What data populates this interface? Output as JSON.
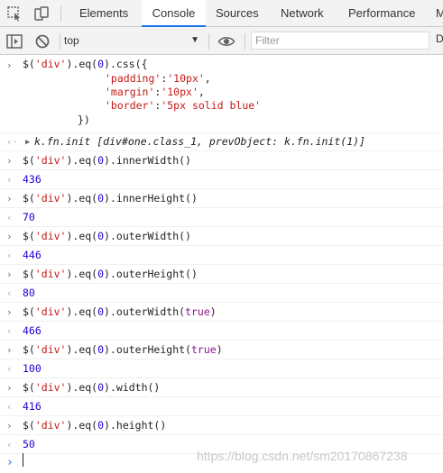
{
  "tabs": [
    {
      "label": "Elements"
    },
    {
      "label": "Console"
    },
    {
      "label": "Sources"
    },
    {
      "label": "Network"
    },
    {
      "label": "Performance"
    },
    {
      "label": "M"
    }
  ],
  "toolbar": {
    "context": "top",
    "filter_placeholder": "Filter",
    "truncated_label": "D"
  },
  "console": {
    "entry1": {
      "line1": "$('div').eq(0).css({",
      "k1": "'padding'",
      "v1": "'10px'",
      "k2": "'margin'",
      "v2": "'10px'",
      "k3": "'border'",
      "v3": "'5px solid blue'",
      "close": "})"
    },
    "result1": {
      "prefix": "k.fn.init [",
      "selector": "div#one.class_1",
      "rest": ", prevObject: k.fn.init(1)]"
    },
    "entries": [
      {
        "pre": "$(",
        "str": "'div'",
        "mid": ").eq(",
        "arg": "0",
        "post": ").innerWidth()",
        "result": "436"
      },
      {
        "pre": "$(",
        "str": "'div'",
        "mid": ").eq(",
        "arg": "0",
        "post": ").innerHeight()",
        "result": "70"
      },
      {
        "pre": "$(",
        "str": "'div'",
        "mid": ").eq(",
        "arg": "0",
        "post": ").outerWidth()",
        "result": "446"
      },
      {
        "pre": "$(",
        "str": "'div'",
        "mid": ").eq(",
        "arg": "0",
        "post": ").outerHeight()",
        "result": "80"
      },
      {
        "pre": "$(",
        "str": "'div'",
        "mid": ").eq(",
        "arg": "0",
        "post": ").outerWidth(",
        "kw": "true",
        "tail": ")",
        "result": "466"
      },
      {
        "pre": "$(",
        "str": "'div'",
        "mid": ").eq(",
        "arg": "0",
        "post": ").outerHeight(",
        "kw": "true",
        "tail": ")",
        "result": "100"
      },
      {
        "pre": "$(",
        "str": "'div'",
        "mid": ").eq(",
        "arg": "0",
        "post": ").width()",
        "result": "416"
      },
      {
        "pre": "$(",
        "str": "'div'",
        "mid": ").eq(",
        "arg": "0",
        "post": ").height()",
        "result": "50"
      }
    ]
  },
  "watermark": "https://blog.csdn.net/sm20170867238"
}
